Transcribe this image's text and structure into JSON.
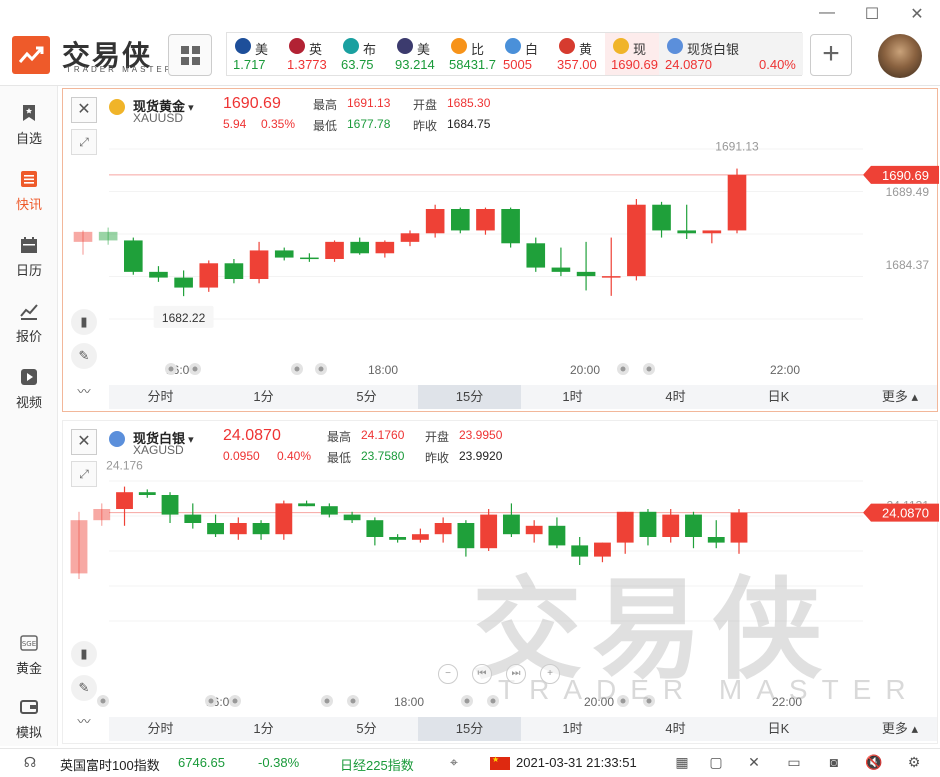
{
  "app": {
    "logo_text": "交易侠",
    "logo_sub": "TRADER MASTER",
    "window": {
      "min": "—",
      "max": "☐",
      "close": "✕"
    }
  },
  "tickers": [
    {
      "name": "美",
      "price": "1.717",
      "price_color": "#1a9a3a",
      "icon_color": "#1e4f9a"
    },
    {
      "name": "英",
      "price": "1.3773",
      "price_color": "#e33",
      "icon_color": "#b22234"
    },
    {
      "name": "布",
      "price": "63.75",
      "price_color": "#1a9a3a",
      "icon_color": "#1aa0a0"
    },
    {
      "name": "美",
      "price": "93.214",
      "price_color": "#1a9a3a",
      "icon_color": "#3c3b6e"
    },
    {
      "name": "比",
      "price": "58431.7",
      "price_color": "#1a9a3a",
      "icon_color": "#f7931a"
    },
    {
      "name": "白",
      "price": "5005",
      "price_color": "#e33",
      "icon_color": "#4a90d9"
    },
    {
      "name": "黄",
      "price": "357.00",
      "price_color": "#e33",
      "icon_color": "#d63b2f"
    },
    {
      "name": "现",
      "price": "1690.69",
      "price_color": "#e33",
      "icon_color": "#f0b429"
    },
    {
      "name": "现货白银",
      "price": "24.0870",
      "change": "0.40%",
      "price_color": "#e33",
      "icon_color": "#5b8fdb"
    }
  ],
  "sidebar": {
    "items": [
      {
        "label": "自选",
        "icon": "bookmark-icon"
      },
      {
        "label": "快讯",
        "icon": "news-icon"
      },
      {
        "label": "日历",
        "icon": "calendar-icon"
      },
      {
        "label": "报价",
        "icon": "quote-icon"
      },
      {
        "label": "视频",
        "icon": "video-icon"
      }
    ],
    "bottom": [
      {
        "label": "黄金",
        "icon": "gold-icon"
      },
      {
        "label": "模拟",
        "icon": "wallet-icon"
      }
    ]
  },
  "panels": [
    {
      "name": "现货黄金",
      "code": "XAUUSD",
      "price": "1690.69",
      "change": "5.94",
      "change_pct": "0.35%",
      "high_label": "最高",
      "high": "1691.13",
      "open_label": "开盘",
      "open": "1685.30",
      "low_label": "最低",
      "low": "1677.78",
      "prev_label": "昨收",
      "prev": "1684.75",
      "icon_color": "#f0b429",
      "chart_data": {
        "type": "candlestick",
        "x_ticks": [
          "16:00",
          "18:00",
          "20:00",
          "22:00"
        ],
        "price_tag": "1690.69",
        "axis_labels": [
          "1689.49",
          "1684.37"
        ],
        "high_annot": "1691.13",
        "low_annot": "1682.22",
        "ylim": [
          1680.6,
          1692.5
        ],
        "candles": [
          [
            1686.0,
            1686.8,
            1685.1,
            1686.7
          ],
          [
            1686.7,
            1687.0,
            1685.8,
            1686.1
          ],
          [
            1686.1,
            1686.3,
            1683.7,
            1683.9
          ],
          [
            1683.9,
            1684.3,
            1683.2,
            1683.5
          ],
          [
            1683.5,
            1684.0,
            1682.2,
            1682.8
          ],
          [
            1682.8,
            1684.7,
            1682.5,
            1684.5
          ],
          [
            1684.5,
            1684.8,
            1683.1,
            1683.4
          ],
          [
            1683.4,
            1686.0,
            1683.1,
            1685.4
          ],
          [
            1685.4,
            1685.6,
            1684.7,
            1684.9
          ],
          [
            1684.9,
            1685.2,
            1684.6,
            1684.8
          ],
          [
            1684.8,
            1686.1,
            1684.6,
            1686.0
          ],
          [
            1686.0,
            1686.3,
            1685.1,
            1685.2
          ],
          [
            1685.2,
            1686.1,
            1684.9,
            1686.0
          ],
          [
            1686.0,
            1686.8,
            1685.7,
            1686.6
          ],
          [
            1686.6,
            1688.6,
            1686.3,
            1688.3
          ],
          [
            1688.3,
            1688.4,
            1686.6,
            1686.8
          ],
          [
            1686.8,
            1688.4,
            1686.5,
            1688.3
          ],
          [
            1688.3,
            1688.4,
            1685.6,
            1685.9
          ],
          [
            1685.9,
            1686.3,
            1683.9,
            1684.2
          ],
          [
            1684.2,
            1685.6,
            1683.6,
            1683.9
          ],
          [
            1683.9,
            1686.0,
            1682.6,
            1683.6
          ],
          [
            1683.5,
            1686.3,
            1682.22,
            1683.6
          ],
          [
            1683.6,
            1689.0,
            1683.3,
            1688.6
          ],
          [
            1688.6,
            1688.8,
            1686.3,
            1686.8
          ],
          [
            1686.8,
            1688.6,
            1686.2,
            1686.6
          ],
          [
            1686.6,
            1686.8,
            1685.9,
            1686.8
          ],
          [
            1686.8,
            1691.13,
            1686.6,
            1690.69
          ]
        ]
      }
    },
    {
      "name": "现货白银",
      "code": "XAGUSD",
      "price": "24.0870",
      "change": "0.0950",
      "change_pct": "0.40%",
      "high_label": "最高",
      "high": "24.1760",
      "open_label": "开盘",
      "open": "23.9950",
      "low_label": "最低",
      "low": "23.7580",
      "prev_label": "昨收",
      "prev": "23.9920",
      "icon_color": "#5b8fdb",
      "chart_data": {
        "type": "candlestick",
        "x_ticks": [
          "16:00",
          "18:00",
          "20:00",
          "22:00"
        ],
        "price_tag": "24.0870",
        "axis_labels": [
          "24.1131"
        ],
        "high_annot": "24.176",
        "ylim": [
          23.7,
          24.2
        ],
        "candles": [
          [
            23.87,
            24.09,
            23.85,
            24.06
          ],
          [
            24.06,
            24.12,
            24.04,
            24.1
          ],
          [
            24.1,
            24.18,
            24.04,
            24.16
          ],
          [
            24.16,
            24.17,
            24.14,
            24.15
          ],
          [
            24.15,
            24.16,
            24.05,
            24.08
          ],
          [
            24.08,
            24.12,
            24.03,
            24.05
          ],
          [
            24.05,
            24.08,
            24.0,
            24.01
          ],
          [
            24.01,
            24.07,
            23.99,
            24.05
          ],
          [
            24.05,
            24.06,
            23.99,
            24.01
          ],
          [
            24.01,
            24.13,
            23.99,
            24.12
          ],
          [
            24.12,
            24.13,
            24.11,
            24.11
          ],
          [
            24.11,
            24.12,
            24.07,
            24.08
          ],
          [
            24.08,
            24.09,
            24.05,
            24.06
          ],
          [
            24.06,
            24.07,
            23.97,
            24.0
          ],
          [
            24.0,
            24.01,
            23.98,
            23.99
          ],
          [
            23.99,
            24.03,
            23.98,
            24.01
          ],
          [
            24.01,
            24.07,
            23.98,
            24.05
          ],
          [
            24.05,
            24.06,
            23.93,
            23.96
          ],
          [
            23.96,
            24.1,
            23.95,
            24.08
          ],
          [
            24.08,
            24.12,
            24.0,
            24.01
          ],
          [
            24.01,
            24.06,
            23.98,
            24.04
          ],
          [
            24.04,
            24.07,
            23.96,
            23.97
          ],
          [
            23.97,
            24.0,
            23.9,
            23.93
          ],
          [
            23.93,
            23.98,
            23.91,
            23.98
          ],
          [
            23.98,
            24.09,
            23.94,
            24.09
          ],
          [
            24.09,
            24.1,
            23.97,
            24.0
          ],
          [
            24.0,
            24.1,
            23.98,
            24.08
          ],
          [
            24.08,
            24.09,
            23.96,
            24.0
          ],
          [
            24.0,
            24.06,
            23.96,
            23.98
          ],
          [
            23.98,
            24.1,
            23.94,
            24.087
          ]
        ]
      }
    }
  ],
  "timeframes": [
    "分时",
    "1分",
    "5分",
    "15分",
    "1时",
    "4时",
    "日K",
    "更多"
  ],
  "selected_timeframe": "15分",
  "statusbar": {
    "index1_name": "英国富时100指数",
    "index1_value": "6746.65",
    "index1_change": "-0.38%",
    "index2_name": "日经225指数",
    "datetime": "2021-03-31  21:33:51"
  },
  "watermark": {
    "main": "交易侠",
    "sub": "TRADER MASTER"
  },
  "colors": {
    "up": "#ee4136",
    "down": "#1fa03a",
    "accent": "#ee5a2a"
  }
}
